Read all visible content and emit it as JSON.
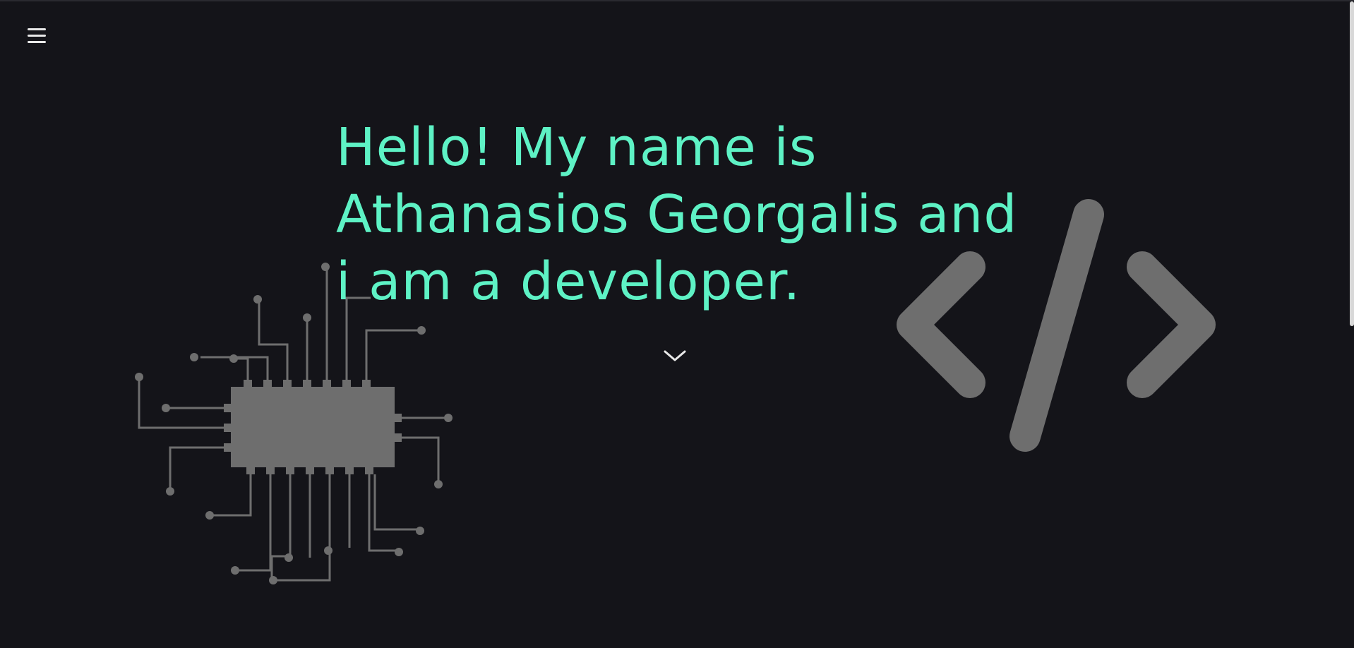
{
  "nav": {
    "menu_icon": "hamburger-menu-icon"
  },
  "hero": {
    "headline_lines": [
      "Hello! My name is",
      "Athanasios Georgalis and",
      "i am a developer."
    ],
    "scroll_icon": "chevron-down-icon",
    "accent_color": "#5ef2c5",
    "background_color": "#141419"
  },
  "decorations": {
    "left_graphic": "circuit-chip-icon",
    "right_graphic": "code-brackets-icon",
    "graphic_color": "#6e6e6e"
  }
}
